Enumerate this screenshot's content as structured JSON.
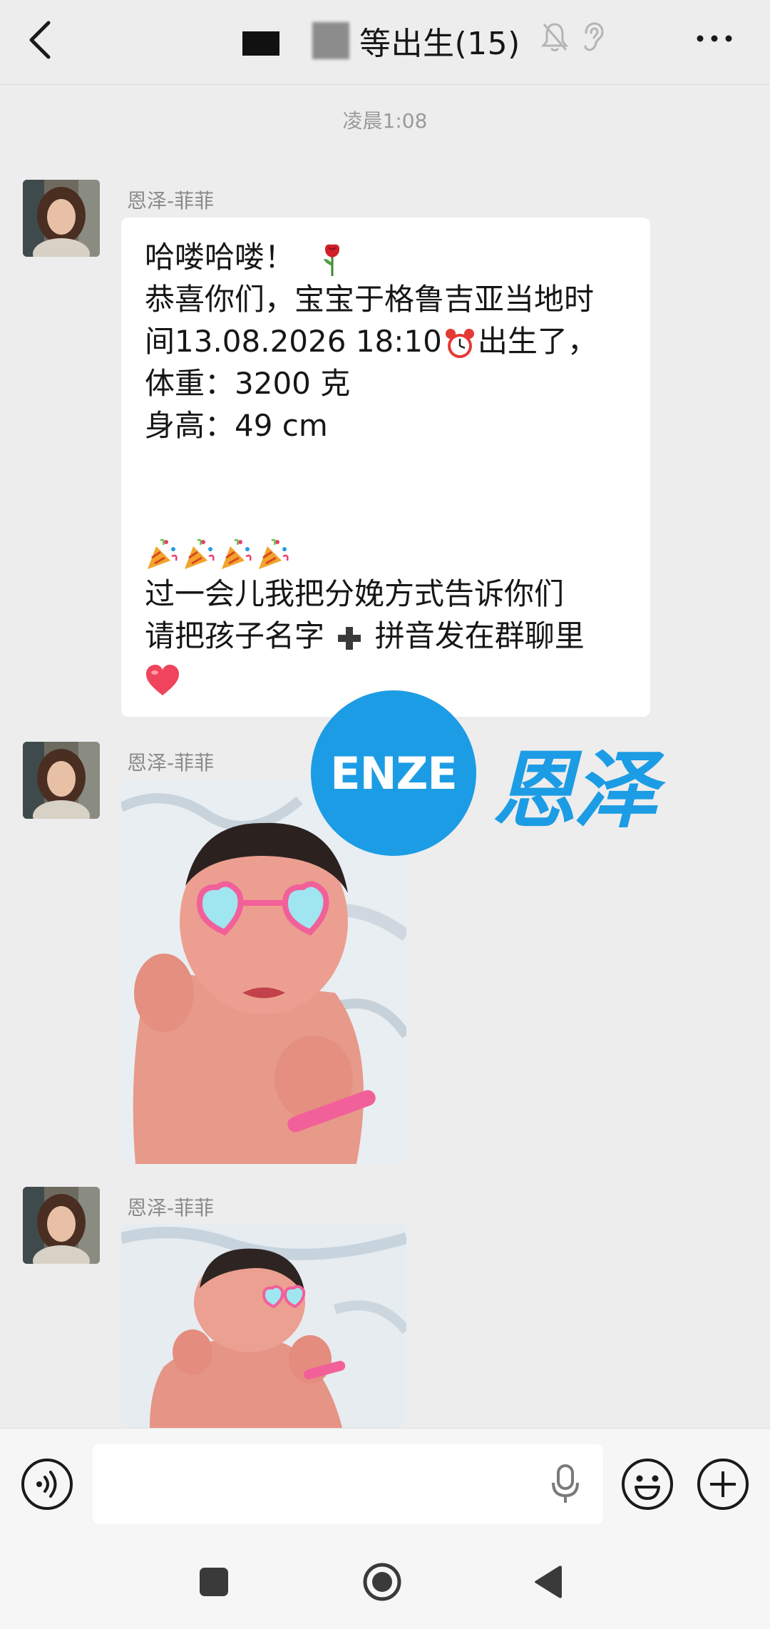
{
  "header": {
    "title": "等出生(15)",
    "back_icon": "chevron-left-icon",
    "mute_icon": "bell-off-icon",
    "ear_icon": "ear-icon",
    "more_icon": "more-horizontal-icon"
  },
  "chat": {
    "timestamp": "凌晨1:08",
    "messages": [
      {
        "sender": "恩泽-菲菲",
        "type": "text",
        "lines": [
          "哈喽哈喽！",
          "恭喜你们，宝宝于格鲁吉亚当地时",
          "间13.08.2026 18:10",
          "出生了，",
          "体重：3200 克",
          "身高：49 cm",
          "过一会儿我把分娩方式告诉你们",
          "请把孩子名字",
          "拼音发在群聊里"
        ],
        "emojis": [
          "rose",
          "alarm-clock",
          "party-popper",
          "heavy-plus",
          "red-heart"
        ]
      },
      {
        "sender": "恩泽-菲菲",
        "type": "image",
        "alt": "newborn-photo-1"
      },
      {
        "sender": "恩泽-菲菲",
        "type": "image",
        "alt": "newborn-photo-2"
      }
    ]
  },
  "watermark": {
    "logo_text": "ENZE",
    "brand_text": "恩泽",
    "color": "#1c9ce4"
  },
  "input_bar": {
    "placeholder": "",
    "voice_icon": "voice-icon",
    "mic_icon": "mic-icon",
    "emoji_icon": "emoji-icon",
    "plus_icon": "plus-circle-icon"
  },
  "nav": {
    "recent_icon": "square-icon",
    "home_icon": "circle-icon",
    "back_icon": "triangle-back-icon"
  },
  "colors": {
    "background": "#ededed",
    "bubble": "#ffffff",
    "text": "#161616",
    "meta": "#8a8a8a"
  }
}
